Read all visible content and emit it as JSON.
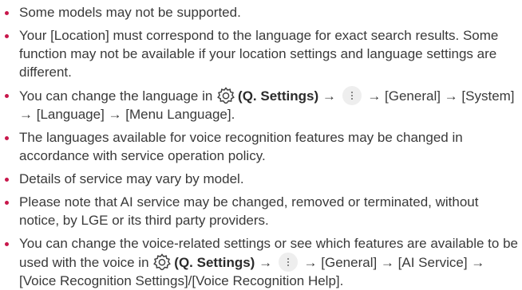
{
  "notes": [
    {
      "text": "Some models may not be supported."
    },
    {
      "text": "Your [Location] must correspond to the language for exact search results. Some function may not be available if your location settings and language settings are different."
    },
    {
      "pre": "You can change the language in",
      "settings_label": "(Q. Settings)",
      "arrow1": "→",
      "path": "→ [General] → [System] → [Language] → [Menu Language]."
    },
    {
      "text": "The languages available for voice recognition features may be changed in accordance with service operation policy."
    },
    {
      "text": "Details of service may vary by model."
    },
    {
      "text": "Please note that AI service may be changed, removed or terminated, without notice, by LGE or its third party providers."
    },
    {
      "pre": "You can change the voice-related settings or see which features are available to be used with the voice in",
      "settings_label": "(Q. Settings)",
      "arrow1": "→",
      "path": "→ [General] → [AI Service] → [Voice Recognition Settings]/[Voice Recognition Help]."
    }
  ],
  "colors": {
    "bullet": "#c8174b",
    "text": "#3a3a3a"
  },
  "icons": [
    "gear-icon",
    "more-options-icon"
  ]
}
